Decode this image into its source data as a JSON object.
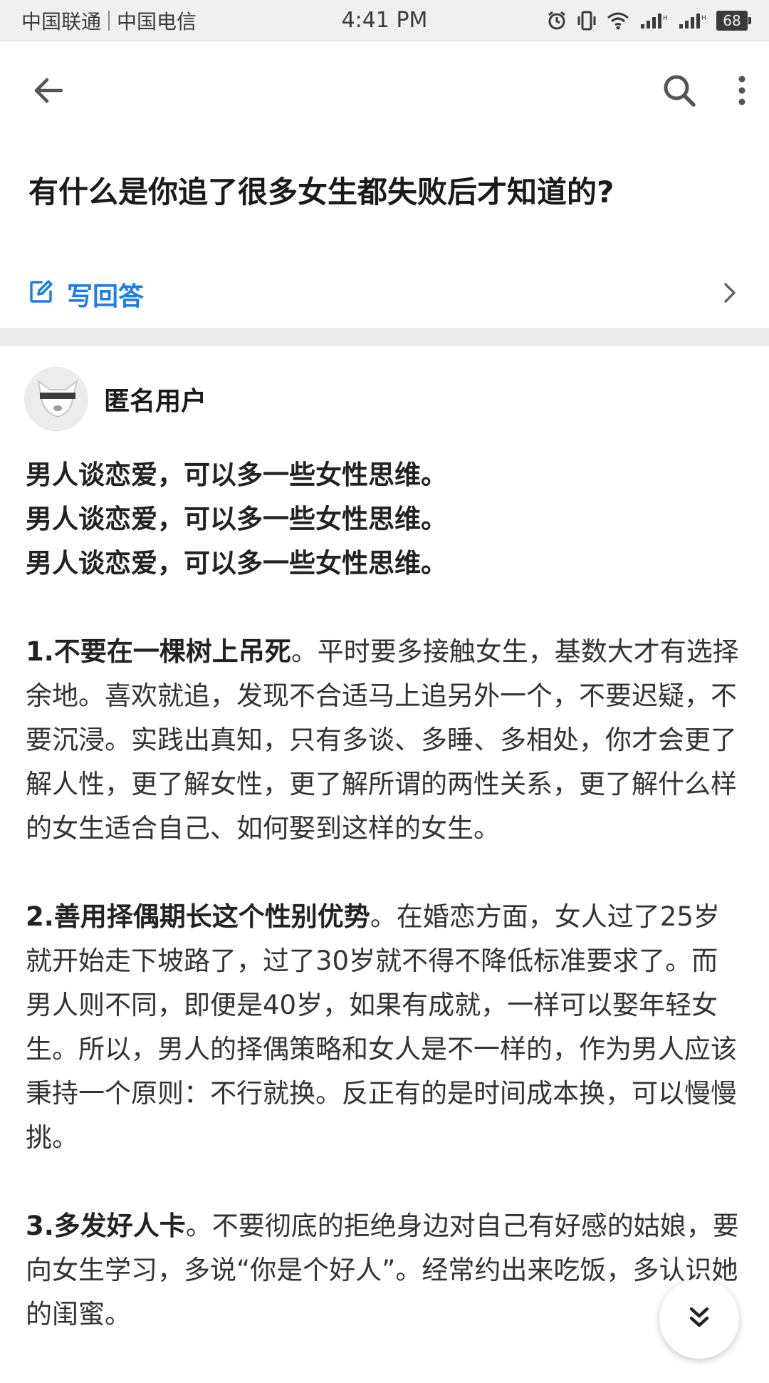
{
  "status_bar": {
    "carrier1": "中国联通",
    "carrier2": "中国电信",
    "time": "4:41 PM",
    "battery": "68"
  },
  "app_bar": {
    "back_icon": "arrow-left-icon",
    "search_icon": "search-icon",
    "more_icon": "more-vertical-icon"
  },
  "question": {
    "title": "有什么是你追了很多女生都失败后才知道的?"
  },
  "write_answer": {
    "label": "写回答",
    "icon": "edit-icon"
  },
  "answer": {
    "author": "匿名用户",
    "lead_lines": [
      "男人谈恋爱，可以多一些女性思维。",
      "男人谈恋爱，可以多一些女性思维。",
      "男人谈恋爱，可以多一些女性思维。"
    ],
    "paragraphs": [
      {
        "heading": "1.不要在一棵树上吊死",
        "text": "。平时要多接触女生，基数大才有选择余地。喜欢就追，发现不合适马上追另外一个，不要迟疑，不要沉浸。实践出真知，只有多谈、多睡、多相处，你才会更了解人性，更了解女性，更了解所谓的两性关系，更了解什么样的女生适合自己、如何娶到这样的女生。"
      },
      {
        "heading": "2.善用择偶期长这个性别优势",
        "text": "。在婚恋方面，女人过了25岁就开始走下坡路了，过了30岁就不得不降低标准要求了。而男人则不同，即便是40岁，如果有成就，一样可以娶年轻女生。所以，男人的择偶策略和女人是不一样的，作为男人应该秉持一个原则：不行就换。反正有的是时间成本换，可以慢慢挑。"
      },
      {
        "heading": "3.多发好人卡",
        "text": "。不要彻底的拒绝身边对自己有好感的姑娘，要向女生学习，多说“你是个好人”。经常约出来吃饭，多认识她的闺蜜。"
      }
    ]
  },
  "fab": {
    "icon": "double-chevron-down-icon"
  }
}
